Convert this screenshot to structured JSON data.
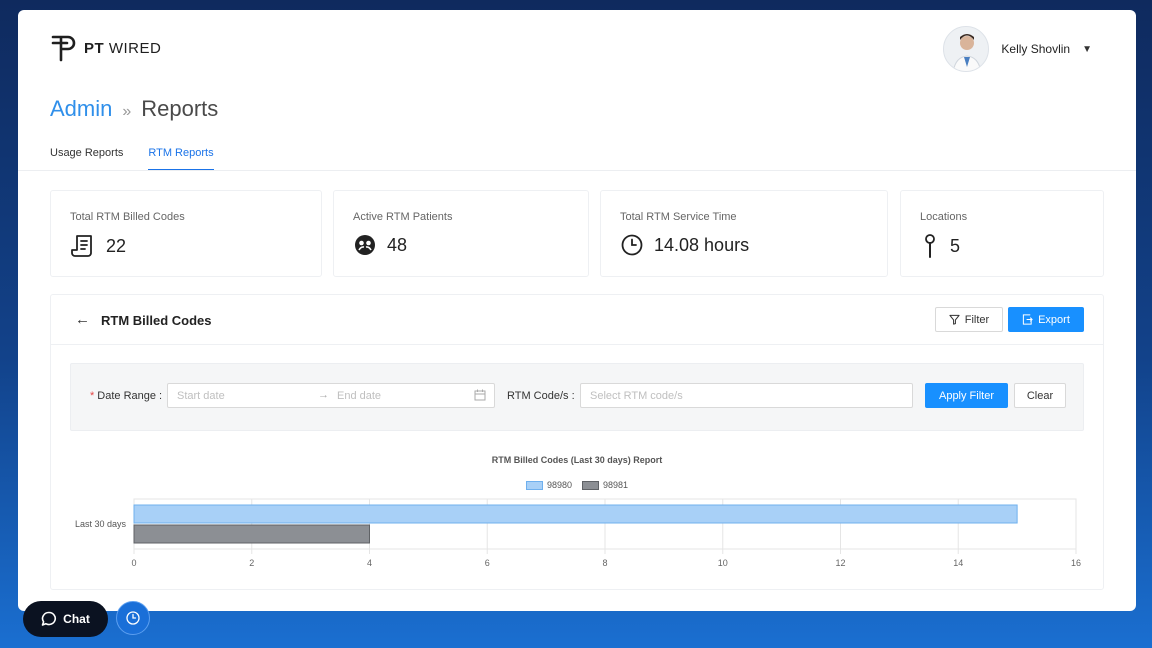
{
  "brand": {
    "logo_prefix": "PT",
    "logo_suffix": "WIRED"
  },
  "user": {
    "name": "Kelly Shovlin",
    "caret": "▼"
  },
  "breadcrumb": {
    "admin": "Admin",
    "separator": "»",
    "current": "Reports"
  },
  "tabs": [
    {
      "label": "Usage Reports",
      "active": false
    },
    {
      "label": "RTM Reports",
      "active": true
    }
  ],
  "stats": [
    {
      "label": "Total RTM Billed Codes",
      "value": "22",
      "icon": "receipt-icon"
    },
    {
      "label": "Active RTM Patients",
      "value": "48",
      "icon": "patients-icon"
    },
    {
      "label": "Total RTM Service Time",
      "value": "14.08 hours",
      "icon": "clock-icon"
    },
    {
      "label": "Locations",
      "value": "5",
      "icon": "pin-icon"
    }
  ],
  "panel": {
    "title": "RTM Billed Codes",
    "back_icon": "←",
    "filter_label": "Filter",
    "export_label": "Export"
  },
  "filters": {
    "required_mark": "*",
    "date_range_label": "Date Range :",
    "start_placeholder": "Start date",
    "end_placeholder": "End date",
    "range_arrow": "→",
    "code_label": "RTM Code/s :",
    "code_placeholder": "Select RTM code/s",
    "apply_label": "Apply Filter",
    "clear_label": "Clear"
  },
  "chart_data": {
    "type": "bar",
    "orientation": "horizontal",
    "title": "RTM Billed Codes (Last 30 days) Report",
    "categories": [
      "Last 30 days"
    ],
    "series": [
      {
        "name": "98980",
        "values": [
          15
        ],
        "color": "#a8d0f7"
      },
      {
        "name": "98981",
        "values": [
          4
        ],
        "color": "#8c8f94"
      }
    ],
    "xlim": [
      0,
      16
    ],
    "xticks": [
      0,
      2,
      4,
      6,
      8,
      10,
      12,
      14,
      16
    ],
    "legend": "top",
    "grid": true
  },
  "floating": {
    "chat_label": "Chat"
  },
  "colors": {
    "accent": "#1890ff",
    "link": "#2f8fea",
    "bg_top": "#0f2a5e",
    "bg_bottom": "#1a6fd1"
  }
}
